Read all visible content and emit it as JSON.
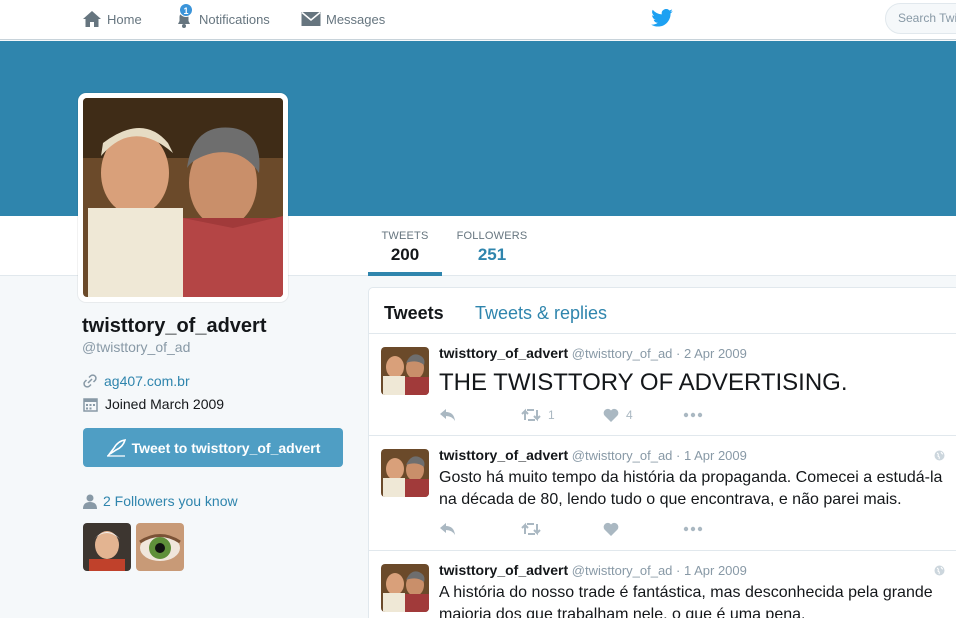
{
  "nav": {
    "home": "Home",
    "notifications": "Notifications",
    "notification_count": "1",
    "messages": "Messages",
    "search_placeholder": "Search Twitter"
  },
  "profile": {
    "display_name": "twisttory_of_advert",
    "screen_name": "@twisttory_of_ad",
    "url": "ag407.com.br",
    "joined": "Joined March 2009",
    "tweet_to_label": "Tweet to twisttory_of_advert",
    "followers_you_know": "2 Followers you know"
  },
  "stats": {
    "tweets_label": "TWEETS",
    "tweets_value": "200",
    "followers_label": "FOLLOWERS",
    "followers_value": "251"
  },
  "timeline": {
    "tabs": [
      "Tweets",
      "Tweets & replies"
    ],
    "tweets": [
      {
        "name": "twisttory_of_advert",
        "handle": "@twisttory_of_ad",
        "date": "· 2 Apr 2009",
        "text": "THE TWISTTORY OF ADVERTISING.",
        "retweets": "1",
        "likes": "4"
      },
      {
        "name": "twisttory_of_advert",
        "handle": "@twisttory_of_ad",
        "date": "· 1 Apr 2009",
        "text": "Gosto há muito tempo da história da propaganda. Comecei a estudá-la na década de 80, lendo tudo o que encontrava, e não parei mais.",
        "retweets": "",
        "likes": ""
      },
      {
        "name": "twisttory_of_advert",
        "handle": "@twisttory_of_ad",
        "date": "· 1 Apr 2009",
        "text": "A história do nosso trade é fantástica, mas desconhecida pela grande maioria dos que trabalham nele, o que é uma pena.",
        "retweets": "",
        "likes": ""
      }
    ]
  },
  "colors": {
    "brand": "#2f85ad",
    "button": "#4f9ec4",
    "twitter_blue": "#1da1f2"
  }
}
